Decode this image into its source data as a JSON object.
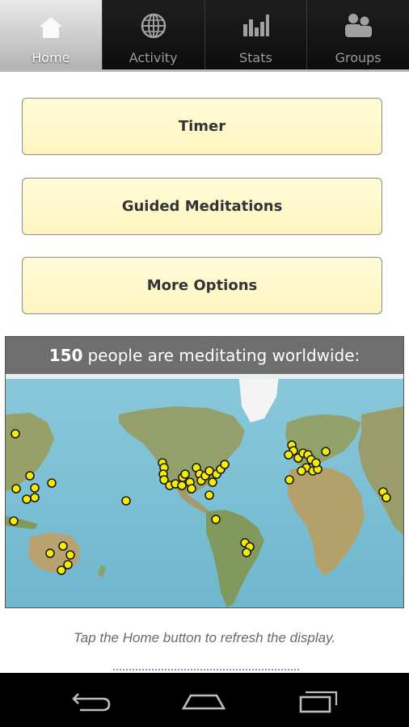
{
  "tabs": [
    {
      "label": "Home",
      "icon": "home-icon",
      "active": true
    },
    {
      "label": "Activity",
      "icon": "globe-icon",
      "active": false
    },
    {
      "label": "Stats",
      "icon": "bar-chart-icon",
      "active": false
    },
    {
      "label": "Groups",
      "icon": "people-icon",
      "active": false
    }
  ],
  "buttons": {
    "timer": "Timer",
    "guided": "Guided Meditations",
    "more": "More Options"
  },
  "world": {
    "count": "150",
    "suffix": "people are meditating worldwide:"
  },
  "refresh_note": "Tap the Home button to refresh the display.",
  "colors": {
    "button_fill": "#fdf6c0",
    "marker_fill": "#f5ec00",
    "ocean": "#7fc3d8",
    "land": "#9aa070"
  },
  "nav": [
    "back-icon",
    "home-icon",
    "recent-apps-icon"
  ]
}
